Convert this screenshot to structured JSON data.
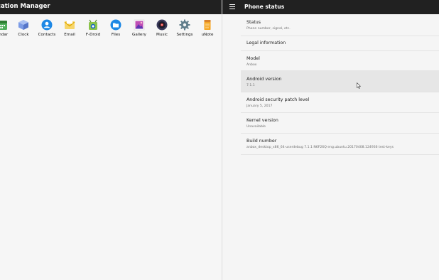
{
  "left_window": {
    "title": "ication Manager",
    "apps": [
      {
        "label": "endar",
        "icon": "calendar-icon",
        "color": "#4fae5a"
      },
      {
        "label": "Clock",
        "icon": "clock-icon",
        "color": "#6f8fd8"
      },
      {
        "label": "Contacts",
        "icon": "contacts-icon",
        "color": "#1e88e5"
      },
      {
        "label": "Email",
        "icon": "email-icon",
        "color": "#f1c232"
      },
      {
        "label": "F-Droid",
        "icon": "fdroid-icon",
        "color": "#8bc34a"
      },
      {
        "label": "Files",
        "icon": "files-icon",
        "color": "#1e88e5"
      },
      {
        "label": "Gallery",
        "icon": "gallery-icon",
        "color": "#a064c8"
      },
      {
        "label": "Music",
        "icon": "music-icon",
        "color": "#3a3a5a"
      },
      {
        "label": "Settings",
        "icon": "settings-icon",
        "color": "#607d8b"
      },
      {
        "label": "uNote",
        "icon": "unote-icon",
        "color": "#f5a623"
      }
    ]
  },
  "right_window": {
    "title": "Phone status",
    "menu_icon": "hamburger-icon",
    "items": [
      {
        "title": "Status",
        "subtitle": "Phone number, signal, etc."
      },
      {
        "title": "Legal information",
        "subtitle": ""
      },
      {
        "title": "Model",
        "subtitle": "Anbox"
      },
      {
        "title": "Android version",
        "subtitle": "7.1.1"
      },
      {
        "title": "Android security patch level",
        "subtitle": "January 5, 2017"
      },
      {
        "title": "Kernel version",
        "subtitle": "Unavailable"
      },
      {
        "title": "Build number",
        "subtitle": "anbox_desktop_x86_64-userdebug 7.1.1 N6F26Q eng.ubuntu.20170408.124936 test-keys"
      }
    ]
  },
  "colors": {
    "titlebar": "#212121",
    "background": "#f5f5f5",
    "selected_row": "#e6e6e6"
  }
}
